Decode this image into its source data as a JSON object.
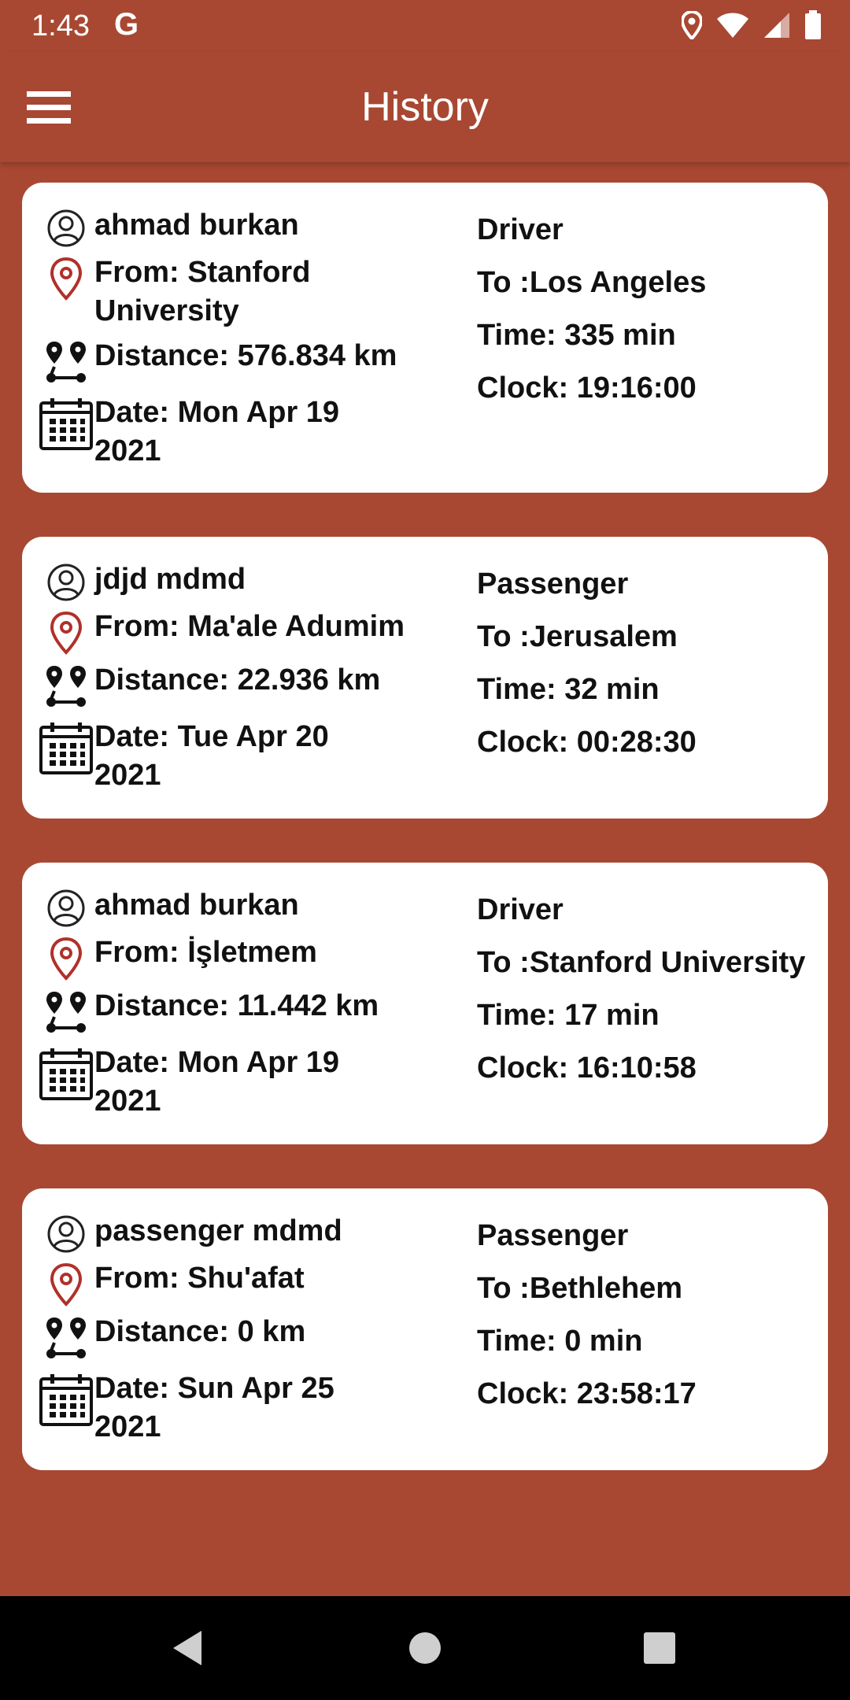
{
  "status_bar": {
    "time": "1:43",
    "g_label": "G",
    "icons": [
      "location-icon",
      "wifi-icon",
      "signal-icon",
      "battery-icon"
    ]
  },
  "app_bar": {
    "title": "History",
    "menu_icon": "hamburger-menu-icon"
  },
  "colors": {
    "background": "#A84832",
    "card": "#FFFFFF",
    "pin": "#B0312A",
    "text": "#111111"
  },
  "trips": [
    {
      "name": "ahmad burkan",
      "from": "From: Stanford University",
      "distance": "Distance: 576.834 km",
      "date": "Date: Mon Apr 19 2021",
      "role": "Driver",
      "to": "To :Los Angeles",
      "time": "Time: 335 min",
      "clock": "Clock: 19:16:00"
    },
    {
      "name": "jdjd mdmd",
      "from": "From: Ma'ale Adumim",
      "distance": "Distance: 22.936 km",
      "date": "Date: Tue Apr 20 2021",
      "role": "Passenger",
      "to": "To :Jerusalem",
      "time": "Time: 32 min",
      "clock": "Clock: 00:28:30"
    },
    {
      "name": "ahmad burkan",
      "from": "From: İşletmem",
      "distance": "Distance: 11.442 km",
      "date": "Date: Mon Apr 19 2021",
      "role": "Driver",
      "to": "To :Stanford University",
      "time": "Time: 17 min",
      "clock": "Clock: 16:10:58"
    },
    {
      "name": "passenger mdmd",
      "from": "From: Shu'afat",
      "distance": "Distance: 0 km",
      "date": "Date: Sun Apr 25 2021",
      "role": "Passenger",
      "to": "To :Bethlehem",
      "time": "Time: 0 min",
      "clock": "Clock: 23:58:17"
    }
  ],
  "nav_bar": {
    "buttons": [
      "back-icon",
      "home-icon",
      "recents-icon"
    ]
  }
}
